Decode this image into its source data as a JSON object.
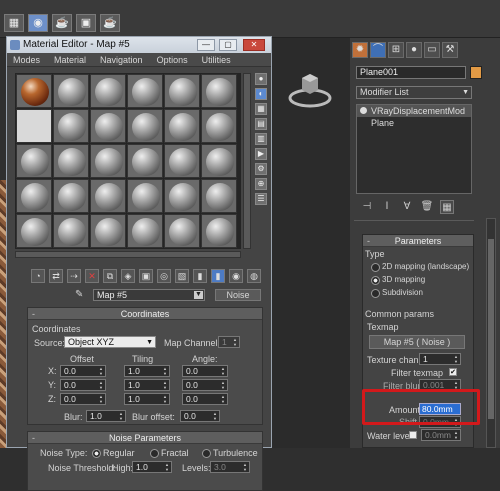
{
  "material_editor": {
    "title": "Material Editor - Map #5",
    "win_buttons": [
      "—",
      "▢",
      "✕"
    ],
    "menu": [
      "Modes",
      "Material",
      "Navigation",
      "Options",
      "Utilities"
    ],
    "map_name": "Map #5",
    "map_type": "Noise",
    "coordinates": {
      "header": "Coordinates",
      "group": "Coordinates",
      "source_label": "Source:",
      "source_value": "Object XYZ",
      "channel_label": "Map Channel:",
      "channel_value": "1",
      "offset_label": "Offset",
      "tiling_label": "Tiling",
      "angle_label": "Angle:",
      "x_label": "X:",
      "y_label": "Y:",
      "z_label": "Z:",
      "offset": [
        "0.0",
        "0.0",
        "0.0"
      ],
      "tiling": [
        "1.0",
        "1.0",
        "1.0"
      ],
      "angle": [
        "0.0",
        "0.0",
        "0.0"
      ],
      "blur_label": "Blur:",
      "blur_value": "1.0",
      "blur_offset_label": "Blur offset:",
      "blur_offset_value": "0.0"
    },
    "noise": {
      "header": "Noise Parameters",
      "type_label": "Noise Type:",
      "types": [
        "Regular",
        "Fractal",
        "Turbulence"
      ],
      "threshold_label": "Noise Threshold:",
      "high_label": "High:",
      "high_value": "1.0",
      "levels_label": "Levels:",
      "levels_value": "3.0"
    }
  },
  "command_panel": {
    "object_name": "Plane001",
    "modifier_list": "Modifier List",
    "stack": [
      "VRayDisplacementMod",
      "Plane"
    ],
    "params_header": "Parameters",
    "type_group": "Type",
    "types": [
      "2D mapping (landscape)",
      "3D mapping",
      "Subdivision"
    ],
    "common_group": "Common params",
    "texmap_label": "Texmap",
    "texmap_button": "Map #5 ( Noise )",
    "texture_chan_label": "Texture chan",
    "texture_chan_value": "1",
    "filter_texmap_label": "Filter texmap",
    "filter_blur_label": "Filter blur",
    "filter_blur_value": "0.001",
    "amount_label": "Amount",
    "amount_value": "80.0mm",
    "shift_label": "Shift",
    "shift_value": "0.0mm",
    "water_level_label": "Water level",
    "water_level_value": "0.0mm"
  },
  "colors": {
    "highlight_box": "#d3191b",
    "selected_input": "#2a6dd1",
    "object_color": "#e29a45"
  }
}
